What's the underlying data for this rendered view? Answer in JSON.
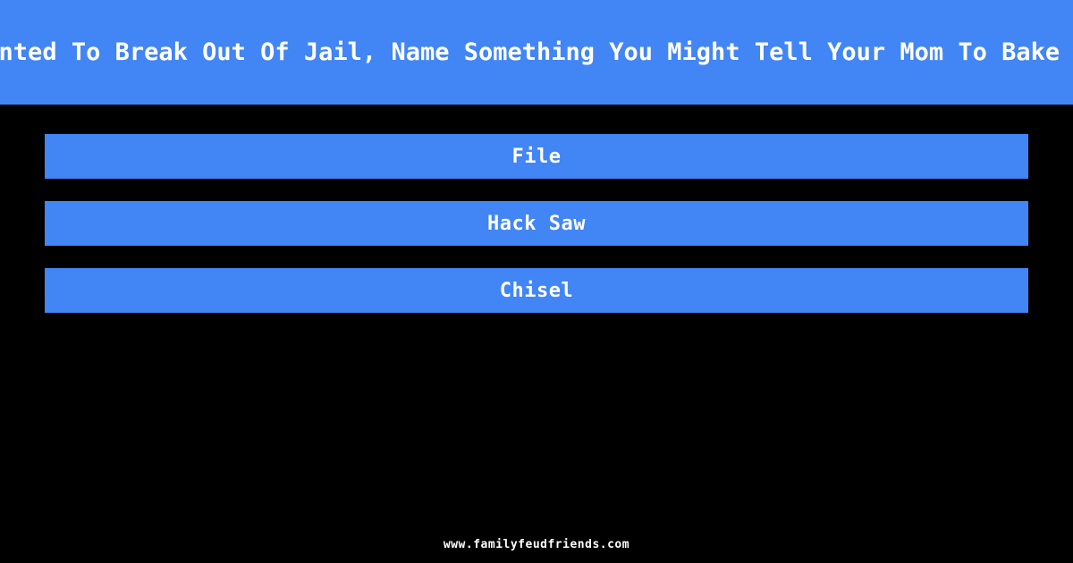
{
  "theme": {
    "background_color": "#000000",
    "accent_color": "#4285F4",
    "text_color": "#FFFFFF"
  },
  "question": {
    "text": "If You Wanted To Break Out Of Jail, Name Something You Might Tell Your Mom To Bake In A Cake",
    "truncated_visible_text": "anted To Break Out Of Jail, Name Something You Might Tell Your Mom To Bake I"
  },
  "answers": [
    {
      "label": "File"
    },
    {
      "label": "Hack Saw"
    },
    {
      "label": "Chisel"
    }
  ],
  "footer": {
    "site": "www.familyfeudfriends.com"
  }
}
